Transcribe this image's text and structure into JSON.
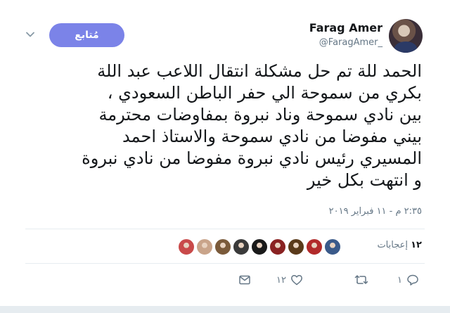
{
  "header": {
    "display_name": "Farag Amer",
    "handle": "@FaragAmer_",
    "follow_label": "مُتابع"
  },
  "tweet": {
    "lines": [
      "الحمد للة تم حل مشكلة انتقال اللاعب عبد اللة",
      "بكري  من سموحة الي حفر الباطن السعودي ،",
      "بين نادي سموحة وناد نبروة  بمفاوضات محترمة",
      "بيني مفوضا من نادي سموحة والاستاذ احمد",
      "المسيري  رئيس نادي نبروة مفوضا من نادي نبروة",
      "و  انتهت بكل خير"
    ],
    "timestamp": "٢:٣٥ م - ١١ فبراير ٢٠١٩"
  },
  "likes": {
    "count": "١٢",
    "label": "إعجابات",
    "liker_colors": [
      "#c94a4a",
      "#c9a48a",
      "#7a5a3a",
      "#3a3a3a",
      "#1a1a1a",
      "#8a2222",
      "#5a3a1a",
      "#b22a2a",
      "#3a5a8a"
    ]
  },
  "actions": {
    "reply_count": "١",
    "retweet_count": "",
    "like_count": "١٢"
  },
  "icons": [
    "chevron-down-icon",
    "reply-icon",
    "retweet-icon",
    "like-icon",
    "message-icon"
  ],
  "colors": {
    "follow_button": "#7b83e8",
    "secondary_text": "#657786",
    "divider": "#e6ecf0"
  }
}
